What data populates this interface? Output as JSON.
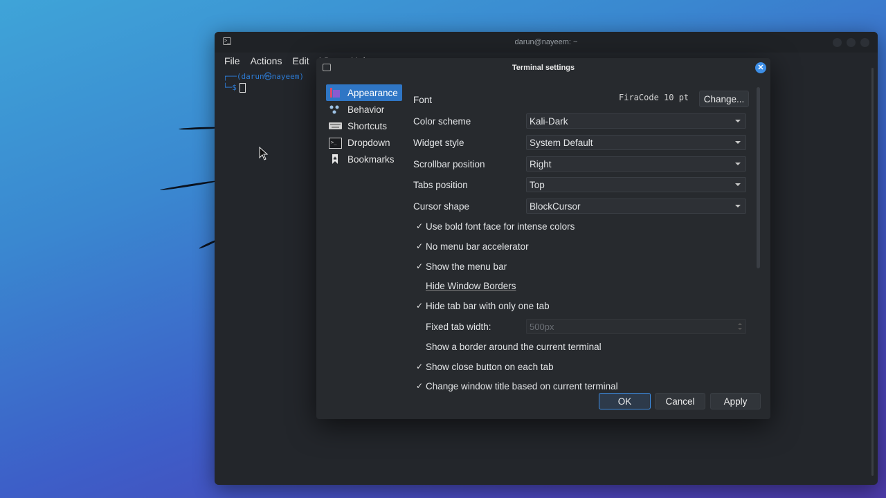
{
  "terminal": {
    "title": "darun@nayeem: ~",
    "menu": [
      "File",
      "Actions",
      "Edit",
      "View",
      "Help"
    ],
    "prompt_user": "(darun㉿nayeem)",
    "prompt_symbol": "$"
  },
  "dialog": {
    "title": "Terminal settings",
    "sidebar": [
      {
        "label": "Appearance",
        "icon": "appearance-icon",
        "active": true
      },
      {
        "label": "Behavior",
        "icon": "behavior-icon",
        "active": false
      },
      {
        "label": "Shortcuts",
        "icon": "keyboard-icon",
        "active": false
      },
      {
        "label": "Dropdown",
        "icon": "terminal-icon",
        "active": false
      },
      {
        "label": "Bookmarks",
        "icon": "bookmark-icon",
        "active": false
      }
    ],
    "font": {
      "label": "Font",
      "value": "FiraCode 10 pt",
      "change_button": "Change..."
    },
    "combos": [
      {
        "label": "Color scheme",
        "value": "Kali-Dark"
      },
      {
        "label": "Widget style",
        "value": "System Default"
      },
      {
        "label": "Scrollbar position",
        "value": "Right"
      },
      {
        "label": "Tabs position",
        "value": "Top"
      },
      {
        "label": "Cursor shape",
        "value": "BlockCursor"
      }
    ],
    "checkboxes": [
      {
        "label": "Use bold font face for intense colors",
        "checked": true
      },
      {
        "label": "No menu bar accelerator",
        "checked": true
      },
      {
        "label": "Show the menu bar",
        "checked": true
      },
      {
        "label": "Hide Window Borders",
        "checked": false
      },
      {
        "label": "Hide tab bar with only one tab",
        "checked": true
      }
    ],
    "fixed_tab_width": {
      "label": "Fixed tab width:",
      "value": "500px",
      "checked": false
    },
    "checkboxes2": [
      {
        "label": "Show a border around the current terminal",
        "checked": false
      },
      {
        "label": "Show close button on each tab",
        "checked": true
      },
      {
        "label": "Change window title based on current terminal",
        "checked": true
      }
    ],
    "buttons": {
      "ok": "OK",
      "cancel": "Cancel",
      "apply": "Apply"
    }
  },
  "colors": {
    "accent": "#2f76c5",
    "close": "#3d8ee6"
  }
}
